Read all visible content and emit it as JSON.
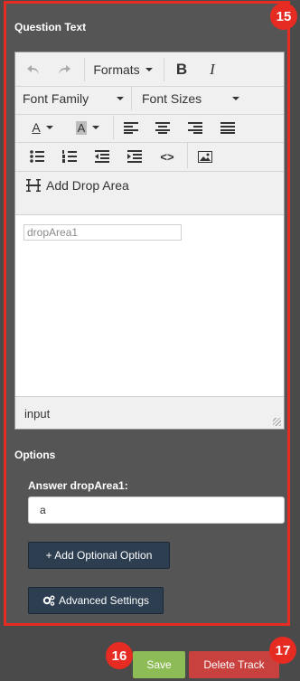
{
  "badges": {
    "panel": "15",
    "save": "16",
    "delete": "17"
  },
  "question_text": {
    "title": "Question Text",
    "toolbar": {
      "formats_label": "Formats",
      "font_family_label": "Font Family",
      "font_sizes_label": "Font Sizes",
      "add_drop_area_label": "Add Drop Area",
      "bold_glyph": "B",
      "italic_glyph": "I",
      "font_color_glyph": "A",
      "bg_color_glyph": "A",
      "code_glyph": "<>"
    },
    "content": {
      "drop_field_value": "dropArea1"
    },
    "status": {
      "path": "input"
    }
  },
  "options": {
    "title": "Options",
    "answer_label": "Answer dropArea1:",
    "answer_value": "a",
    "add_optional_label": "+ Add Optional Option",
    "advanced_label": "Advanced Settings"
  },
  "footer": {
    "save_label": "Save",
    "delete_label": "Delete Track"
  },
  "colors": {
    "highlight": "#e52b22",
    "save": "#8dbb55",
    "delete": "#c9413f",
    "dark_button": "#2c3e50"
  }
}
